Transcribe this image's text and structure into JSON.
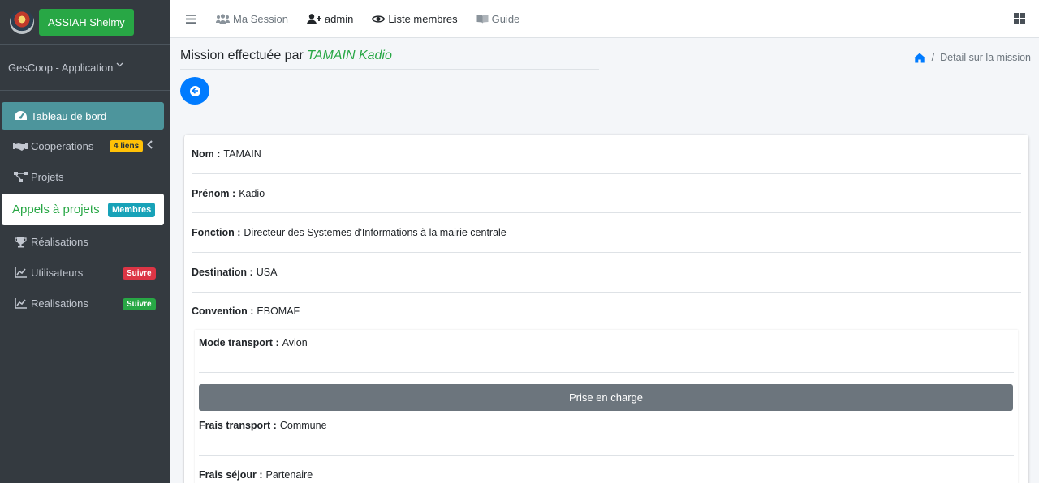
{
  "brand": {
    "user_button": "ASSIAH Shelmy"
  },
  "app_name": "GesCoop - Application",
  "sidebar": {
    "items": [
      {
        "label": "Tableau de bord",
        "badge": ""
      },
      {
        "label": "Cooperations",
        "badge": "4 liens"
      },
      {
        "label": "Projets",
        "badge": ""
      },
      {
        "label": "Appels à projets",
        "badge": "Membres"
      },
      {
        "label": "Réalisations",
        "badge": ""
      },
      {
        "label": "Utilisateurs",
        "badge": "Suivre"
      },
      {
        "label": "Realisations",
        "badge": "Suivre"
      }
    ]
  },
  "topbar": {
    "session": "Ma Session",
    "admin": "admin",
    "members": "Liste membres",
    "guide": "Guide"
  },
  "header": {
    "title_prefix": "Mission effectuée par",
    "title_name": "TAMAIN Kadio",
    "breadcrumb_current": "Detail sur la mission",
    "breadcrumb_sep": "/"
  },
  "details": {
    "nom_label": "Nom :",
    "nom": "TAMAIN",
    "prenom_label": "Prénom :",
    "prenom": "Kadio",
    "fonction_label": "Fonction :",
    "fonction": "Directeur des Systemes d'Informations à la mairie centrale",
    "destination_label": "Destination :",
    "destination": "USA",
    "convention_label": "Convention :",
    "convention": "EBOMAF",
    "mode_label": "Mode transport :",
    "mode": "Avion",
    "prise_button": "Prise en charge",
    "frais_transport_label": "Frais transport :",
    "frais_transport": "Commune",
    "frais_sejour_label": "Frais séjour :",
    "frais_sejour": "Partenaire"
  },
  "colors": {
    "accent": "#28a745",
    "primary": "#007bff",
    "sidebar": "#343a40",
    "active": "#4d959c"
  }
}
